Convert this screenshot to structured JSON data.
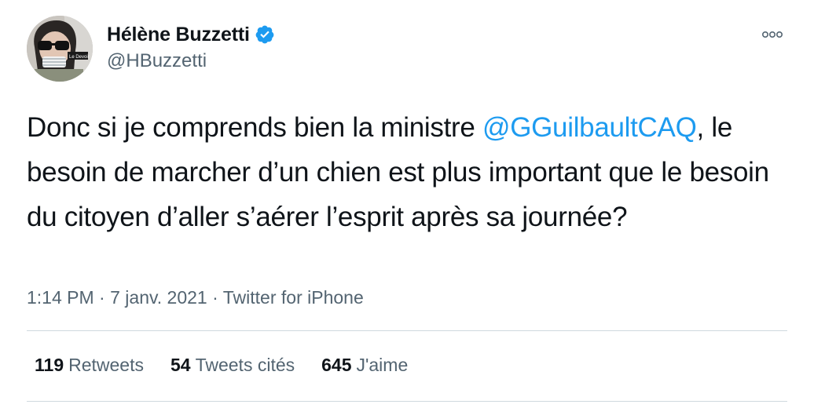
{
  "author": {
    "display_name": "Hélène Buzzetti",
    "handle": "@HBuzzetti",
    "verified": true,
    "avatar_badge_text": "Le Devoir"
  },
  "tweet": {
    "text_before": "Donc si je comprends bien la ministre ",
    "mention": "@GGuilbaultCAQ",
    "text_after": ", le besoin de marcher d’un chien est plus important que le besoin du citoyen d’aller s’aérer l’esprit après sa journée?"
  },
  "meta": {
    "time": "1:14 PM",
    "separator": "·",
    "date": "7 janv. 2021",
    "source": "Twitter for iPhone"
  },
  "stats": {
    "retweets_count": "119",
    "retweets_label": "Retweets",
    "quotes_count": "54",
    "quotes_label": "Tweets cités",
    "likes_count": "645",
    "likes_label": "J'aime"
  },
  "colors": {
    "accent": "#1d9bf0",
    "text": "#0f1419",
    "secondary": "#536471",
    "divider": "#cfd9de"
  },
  "icons": {
    "verified": "verified-badge-icon",
    "more": "more-options-icon"
  }
}
